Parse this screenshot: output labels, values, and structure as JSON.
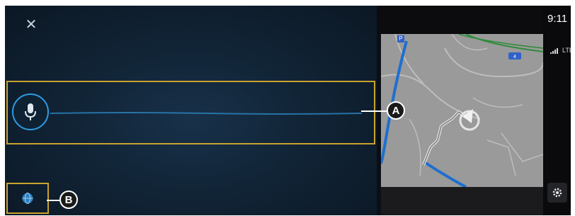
{
  "voice_panel": {
    "close_icon": "close-icon",
    "title": "",
    "mic_icon": "microphone-icon",
    "language_icon": "globe-icon"
  },
  "map": {
    "route_badge": "P"
  },
  "status": {
    "time": "9:11",
    "network": "LTE",
    "settings_icon": "gear-icon"
  },
  "callouts": {
    "a": "A",
    "b": "B"
  },
  "colors": {
    "accent": "#2d9be3",
    "highlight": "#c9a22f",
    "panel": "#112436"
  }
}
